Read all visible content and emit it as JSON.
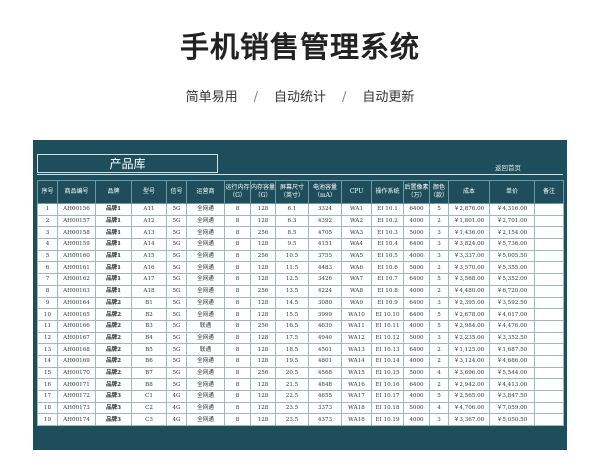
{
  "header": {
    "title": "手机销售管理系统",
    "subtitle_parts": [
      "简单易用",
      "自动统计",
      "自动更新"
    ],
    "separator": "/"
  },
  "sheet": {
    "banner": "产品库",
    "back_link": "返回首页",
    "columns": [
      "序号",
      "商品编号",
      "品牌",
      "型号",
      "信号",
      "运营商",
      "运行内存（G）",
      "内存容量（G）",
      "屏幕尺寸（英寸）",
      "电池容量（mA）",
      "CPU",
      "操作系统",
      "后置像素（万）",
      "颜色（款）",
      "成本",
      "单价",
      "备注"
    ],
    "rows": [
      [
        "1",
        "AH00156",
        "品牌1",
        "A11",
        "5G",
        "全网通",
        "8",
        "128",
        "6.1",
        "3324",
        "WA1",
        "EI 10.1",
        "6400",
        "5",
        "￥2,876.00",
        "￥4,316.00",
        ""
      ],
      [
        "2",
        "AH00157",
        "品牌1",
        "A12",
        "5G",
        "全网通",
        "8",
        "128",
        "6.3",
        "4392",
        "WA2",
        "EI 10.2",
        "4000",
        "2",
        "￥1,801.00",
        "￥2,701.00",
        ""
      ],
      [
        "3",
        "AH00158",
        "品牌1",
        "A13",
        "5G",
        "全网通",
        "8",
        "256",
        "8.5",
        "4705",
        "WA3",
        "EI 10.3",
        "5000",
        "3",
        "￥1,436.00",
        "￥2,154.00",
        ""
      ],
      [
        "4",
        "AH00159",
        "品牌1",
        "A14",
        "5G",
        "全网通",
        "8",
        "128",
        "9.5",
        "4151",
        "WA4",
        "EI 10.4",
        "6400",
        "3",
        "￥3,824.00",
        "￥5,736.00",
        ""
      ],
      [
        "5",
        "AH00160",
        "品牌1",
        "A15",
        "5G",
        "全网通",
        "8",
        "256",
        "10.5",
        "3755",
        "WA5",
        "EI 10.5",
        "4000",
        "3",
        "￥3,337.00",
        "￥5,005.50",
        ""
      ],
      [
        "6",
        "AH00161",
        "品牌1",
        "A16",
        "5G",
        "全网通",
        "8",
        "128",
        "11.5",
        "4483",
        "WA6",
        "EI 10.6",
        "5000",
        "2",
        "￥3,570.00",
        "￥5,355.00",
        ""
      ],
      [
        "7",
        "AH00162",
        "品牌1",
        "A17",
        "5G",
        "全网通",
        "8",
        "128",
        "12.5",
        "3426",
        "WA7",
        "EI 10.7",
        "6400",
        "5",
        "￥3,568.00",
        "￥5,352.00",
        ""
      ],
      [
        "8",
        "AH00163",
        "品牌1",
        "A18",
        "5G",
        "全网通",
        "8",
        "256",
        "13.5",
        "4224",
        "WA8",
        "EI 10.8",
        "4000",
        "2",
        "￥4,480.00",
        "￥6,720.00",
        ""
      ],
      [
        "9",
        "AH00164",
        "品牌2",
        "B1",
        "5G",
        "全网通",
        "8",
        "128",
        "14.5",
        "3080",
        "WA9",
        "EI 10.9",
        "6400",
        "3",
        "￥2,395.00",
        "￥3,592.50",
        ""
      ],
      [
        "10",
        "AH00165",
        "品牌2",
        "B2",
        "5G",
        "全网通",
        "8",
        "128",
        "15.5",
        "3999",
        "WA10",
        "EI 10.10",
        "6400",
        "5",
        "￥2,678.00",
        "￥4,017.00",
        ""
      ],
      [
        "11",
        "AH00166",
        "品牌2",
        "B3",
        "5G",
        "联通",
        "8",
        "256",
        "16.5",
        "4639",
        "WA11",
        "EI 10.11",
        "4000",
        "5",
        "￥2,984.00",
        "￥4,476.00",
        ""
      ],
      [
        "12",
        "AH00167",
        "品牌2",
        "B4",
        "5G",
        "全网通",
        "8",
        "128",
        "17.5",
        "4940",
        "WA12",
        "EI 10.12",
        "5000",
        "3",
        "￥2,235.00",
        "￥3,352.50",
        ""
      ],
      [
        "13",
        "AH00168",
        "品牌2",
        "B5",
        "5G",
        "联通",
        "8",
        "128",
        "18.5",
        "4501",
        "WA13",
        "EI 10.13",
        "6400",
        "2",
        "￥1,125.00",
        "￥1,687.50",
        ""
      ],
      [
        "14",
        "AH00169",
        "品牌2",
        "B6",
        "5G",
        "全网通",
        "8",
        "128",
        "19.5",
        "4801",
        "WA14",
        "EI 10.14",
        "4000",
        "2",
        "￥3,124.00",
        "￥4,686.00",
        ""
      ],
      [
        "15",
        "AH00170",
        "品牌2",
        "B7",
        "5G",
        "全网通",
        "8",
        "256",
        "20.5",
        "4568",
        "WA15",
        "EI 10.15",
        "5000",
        "4",
        "￥3,696.00",
        "￥5,544.00",
        ""
      ],
      [
        "16",
        "AH00171",
        "品牌2",
        "B8",
        "5G",
        "全网通",
        "8",
        "128",
        "21.5",
        "4848",
        "WA16",
        "EI 10.16",
        "6400",
        "2",
        "￥2,942.00",
        "￥4,413.00",
        ""
      ],
      [
        "17",
        "AH00172",
        "品牌3",
        "C1",
        "4G",
        "全网通",
        "8",
        "128",
        "22.5",
        "4655",
        "WA17",
        "EI 10.17",
        "4000",
        "5",
        "￥2,565.00",
        "￥3,847.50",
        ""
      ],
      [
        "18",
        "AH00173",
        "品牌3",
        "C2",
        "4G",
        "全网通",
        "8",
        "128",
        "23.5",
        "3373",
        "WA18",
        "EI 10.18",
        "5000",
        "4",
        "￥4,706.00",
        "￥7,059.00",
        ""
      ],
      [
        "19",
        "AH00174",
        "品牌3",
        "C3",
        "4G",
        "全网通",
        "8",
        "128",
        "23.5",
        "4373",
        "WA18",
        "EI 10.19",
        "4000",
        "3",
        "￥3,367.00",
        "￥5,050.50",
        ""
      ]
    ]
  }
}
